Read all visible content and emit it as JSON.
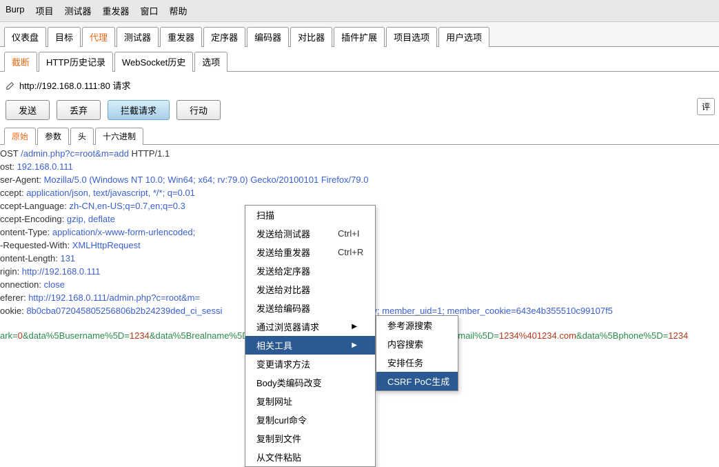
{
  "menubar": [
    "Burp",
    "项目",
    "测试器",
    "重发器",
    "窗口",
    "帮助"
  ],
  "toptabs": [
    "仪表盘",
    "目标",
    "代理",
    "测试器",
    "重发器",
    "定序器",
    "编码器",
    "对比器",
    "插件扩展",
    "项目选项",
    "用户选项"
  ],
  "toptab_active": 2,
  "subtabs": [
    "截断",
    "HTTP历史记录",
    "WebSocket历史",
    "选项"
  ],
  "subtab_active": 0,
  "url": "http://192.168.0.111:80 请求",
  "buttons": {
    "send": "发送",
    "drop": "丢弃",
    "intercept": "拦截请求",
    "action": "行动",
    "comment": "评"
  },
  "viewtabs": [
    "原始",
    "参数",
    "头",
    "十六进制"
  ],
  "viewtab_active": 0,
  "raw": {
    "l1a": "OST ",
    "l1b": "/admin.php?c=root&m=add",
    "l1c": " HTTP/1.1",
    "l2a": "ost: ",
    "l2b": "192.168.0.111",
    "l3a": "ser-Agent: ",
    "l3b": "Mozilla/5.0 (Windows NT 10.0; Win64; x64; rv:79.0) Gecko/20100101 Firefox/79.0",
    "l4a": "ccept: ",
    "l4b": "application/json, text/javascript, */*; q=0.01",
    "l5a": "ccept-Language: ",
    "l5b": "zh-CN,en-US;q=0.7,en;q=0.3",
    "l6a": "ccept-Encoding: ",
    "l6b": "gzip, deflate",
    "l7a": "ontent-Type: ",
    "l7b": "application/x-www-form-urlencoded; ",
    "l8a": "-Requested-With: ",
    "l8b": "XMLHttpRequest",
    "l9a": "ontent-Length: ",
    "l9b": "131",
    "l10a": "rigin: ",
    "l10b": "http://192.168.0.111",
    "l11a": "onnection: ",
    "l11b": "close",
    "l12a": "eferer: ",
    "l12b": "http://192.168.0.111/admin.php?c=root&m=",
    "l13a": "ookie: ",
    "l13b": "8b0cba072045805256806b2b24239ded_ci_sessi",
    "l13c": "gvorcv; member_uid=1; member_cookie=643e4b355510c99107f5",
    "l15a": "ark=",
    "l15b": "0",
    "l15c": "&data%5Busername%5D=",
    "l15d": "1234",
    "l15e": "&data%5Brealname%5D",
    "l15f": "&data%5Bemail%5D=",
    "l15g": "1234%401234.com",
    "l15h": "&data%5Bphone%5D=",
    "l15i": "1234"
  },
  "menu1": [
    {
      "label": "扫描"
    },
    {
      "label": "发送给测试器",
      "shortcut": "Ctrl+I"
    },
    {
      "label": "发送给重发器",
      "shortcut": "Ctrl+R"
    },
    {
      "label": "发送给定序器"
    },
    {
      "label": "发送给对比器"
    },
    {
      "label": "发送给编码器"
    },
    {
      "label": "通过浏览器请求",
      "arrow": true
    },
    {
      "label": "相关工具",
      "arrow": true,
      "hl": true
    },
    {
      "label": "变更请求方法"
    },
    {
      "label": "Body类编码改变"
    },
    {
      "label": "复制网址"
    },
    {
      "label": "复制curl命令"
    },
    {
      "label": "复制到文件"
    },
    {
      "label": "从文件粘贴"
    }
  ],
  "menu2": [
    {
      "label": "参考源搜索"
    },
    {
      "label": "内容搜索"
    },
    {
      "label": "安排任务"
    },
    {
      "label": "CSRF PoC生成",
      "hl": true
    }
  ]
}
